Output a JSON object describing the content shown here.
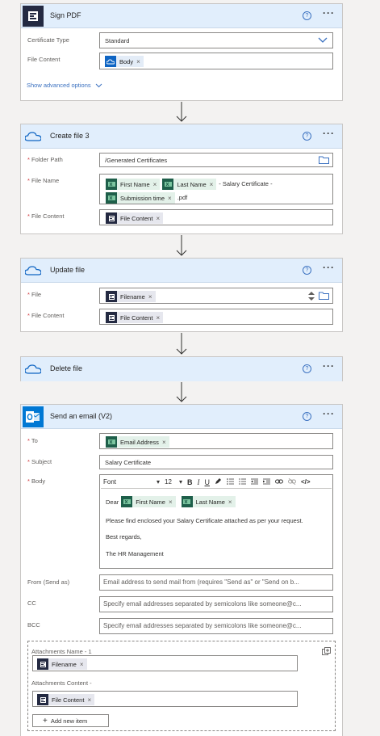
{
  "sign_pdf": {
    "title": "Sign PDF",
    "certificate_type_label": "Certificate Type",
    "certificate_type_value": "Standard",
    "file_content_label": "File Content",
    "file_content_token": "Body",
    "advanced_link": "Show advanced options"
  },
  "create_file": {
    "title": "Create file 3",
    "folder_path_label": "Folder Path",
    "folder_path_value": "/Generated Certificates",
    "file_name_label": "File Name",
    "file_name_token1": "First Name",
    "file_name_token2": "Last Name",
    "file_name_text1": "- Salary Certificate -",
    "file_name_token3": "Submission time",
    "file_name_text2": ".pdf",
    "file_content_label": "File Content",
    "file_content_token": "File Content"
  },
  "update_file": {
    "title": "Update file",
    "file_label": "File",
    "file_token": "Filename",
    "file_content_label": "File Content",
    "file_content_token": "File Content"
  },
  "delete_file": {
    "title": "Delete file"
  },
  "send_email": {
    "title": "Send an email (V2)",
    "to_label": "To",
    "to_token": "Email Address",
    "subject_label": "Subject",
    "subject_value": "Salary Certificate",
    "body_label": "Body",
    "font_label": "Font",
    "font_size": "12",
    "body_dear": "Dear",
    "body_token1": "First Name",
    "body_token2": "Last Name",
    "body_line1": "Please find enclosed your Salary Certificate attached as per your request.",
    "body_line2": "Best regards,",
    "body_line3": "The HR Management",
    "from_label": "From (Send as)",
    "from_placeholder": "Email address to send mail from (requires \"Send as\" or \"Send on b...",
    "cc_label": "CC",
    "cc_placeholder": "Specify email addresses separated by semicolons like someone@c...",
    "bcc_label": "BCC",
    "bcc_placeholder": "Specify email addresses separated by semicolons like someone@c...",
    "att_name_label": "Attachments Name - 1",
    "att_name_token": "Filename",
    "att_content_label": "Attachments Content -",
    "att_content_token": "File Content",
    "add_item": "Add new item"
  },
  "colors": {
    "header_bg": "#e1eefc",
    "accent": "#3b71c0",
    "required": "#d13438"
  }
}
